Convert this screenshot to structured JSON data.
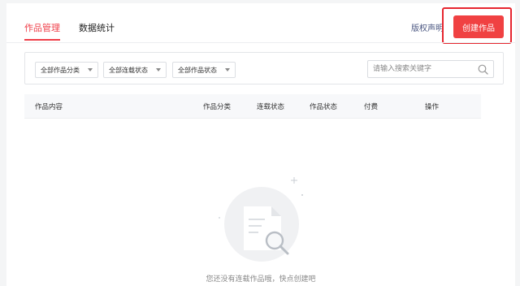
{
  "tabs": [
    {
      "label": "作品管理",
      "active": true
    },
    {
      "label": "数据统计",
      "active": false
    }
  ],
  "header": {
    "copyright_link": "版权声明",
    "create_button": "创建作品"
  },
  "filters": {
    "category": "全部作品分类",
    "serial_status": "全部连载状态",
    "work_status": "全部作品状态"
  },
  "search": {
    "placeholder": "请输入搜索关键字",
    "value": ""
  },
  "table": {
    "columns": [
      "作品内容",
      "作品分类",
      "连载状态",
      "作品状态",
      "付费",
      "操作"
    ]
  },
  "empty_state": {
    "message": "您还没有连载作品哦，快点创建吧"
  },
  "colors": {
    "accent": "#ef3e48",
    "button_bg": "#f04142",
    "highlight_border": "#e6262f",
    "link": "#4a5680"
  }
}
